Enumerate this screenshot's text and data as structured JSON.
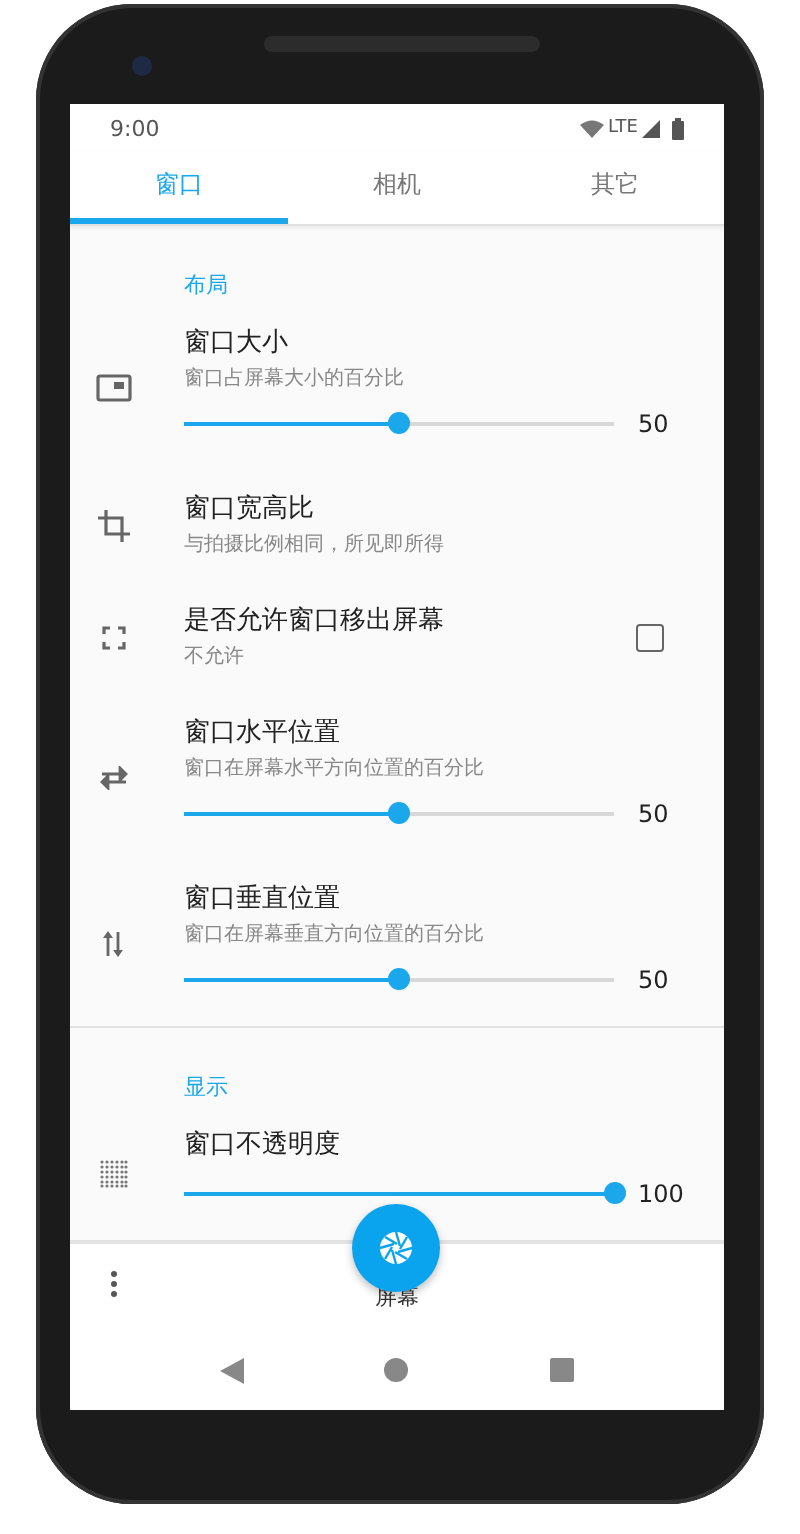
{
  "status_bar": {
    "time": "9:00",
    "network": "LTE"
  },
  "tabs": [
    {
      "label": "窗口",
      "selected": true
    },
    {
      "label": "相机",
      "selected": false
    },
    {
      "label": "其它",
      "selected": false
    }
  ],
  "sections": [
    {
      "title": "布局",
      "items": [
        {
          "kind": "slider",
          "title": "窗口大小",
          "subtitle": "窗口占屏幕大小的百分比",
          "level": 0.5,
          "value": "50"
        },
        {
          "kind": "plain",
          "title": "窗口宽高比",
          "subtitle": "与拍摄比例相同，所见即所得"
        },
        {
          "kind": "checkbox",
          "title": "是否允许窗口移出屏幕",
          "subtitle": "不允许",
          "checked": false
        },
        {
          "kind": "slider",
          "title": "窗口水平位置",
          "subtitle": "窗口在屏幕水平方向位置的百分比",
          "level": 0.5,
          "value": "50"
        },
        {
          "kind": "slider",
          "title": "窗口垂直位置",
          "subtitle": "窗口在屏幕垂直方向位置的百分比",
          "level": 0.5,
          "value": "50"
        }
      ]
    },
    {
      "title": "显示",
      "items": [
        {
          "kind": "slider",
          "title": "窗口不透明度",
          "level": 1,
          "value": "100"
        }
      ]
    }
  ],
  "bottom_bar": {
    "fab_caption": "屏幕"
  }
}
